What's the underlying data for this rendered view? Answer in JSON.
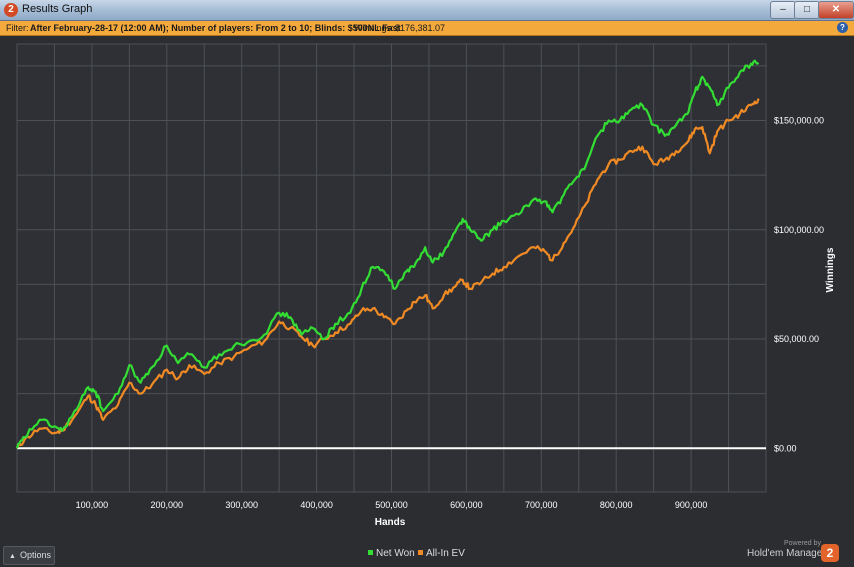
{
  "window": {
    "title": "Results Graph",
    "app_icon_text": "2",
    "minimize_glyph": "–",
    "maximize_glyph": "□",
    "close_glyph": "✕"
  },
  "filter": {
    "label": "Filter:",
    "text": "After February-28-17 (12:00 AM); Number of players: From 2 to 10; Blinds: $500NL Fast",
    "winnings_label": "Winnings:",
    "winnings_value": "$176,381.07",
    "help_icon": "?"
  },
  "bottom": {
    "options_label": "Options",
    "options_icon": "caret-up-icon",
    "powered_by": "Powered by",
    "brand_name": "Hold'em Manager",
    "brand_logo_text": "2"
  },
  "colors": {
    "background": "#2b2d31",
    "grid": "#4d5055",
    "net_won": "#33dd33",
    "all_in_ev": "#f08a24",
    "zero_line": "#ffffff",
    "filter_bar": "#f3a93c"
  },
  "chart_data": {
    "type": "line",
    "title": "",
    "xlabel": "Hands",
    "ylabel": "Winnings",
    "xlim": [
      0,
      1000000
    ],
    "ylim": [
      -20000,
      185000
    ],
    "x_ticks": [
      100000,
      200000,
      300000,
      400000,
      500000,
      600000,
      700000,
      800000,
      900000
    ],
    "x_tick_labels": [
      "100,000",
      "200,000",
      "300,000",
      "400,000",
      "500,000",
      "600,000",
      "700,000",
      "800,000",
      "900,000"
    ],
    "y_ticks": [
      0,
      50000,
      100000,
      150000
    ],
    "y_tick_labels": [
      "$0.00",
      "$50,000.00",
      "$100,000.00",
      "$150,000.00"
    ],
    "grid": true,
    "legend_position": "bottom-center",
    "series": [
      {
        "name": "Net Won",
        "color": "#33dd33",
        "x": [
          0,
          10000,
          30000,
          50000,
          60000,
          80000,
          95000,
          105000,
          115000,
          135000,
          150000,
          165000,
          180000,
          200000,
          215000,
          230000,
          250000,
          270000,
          290000,
          310000,
          330000,
          350000,
          365000,
          380000,
          395000,
          410000,
          425000,
          445000,
          460000,
          475000,
          490000,
          505000,
          520000,
          530000,
          545000,
          555000,
          570000,
          585000,
          595000,
          605000,
          620000,
          635000,
          650000,
          670000,
          690000,
          705000,
          715000,
          730000,
          745000,
          760000,
          775000,
          790000,
          805000,
          820000,
          835000,
          850000,
          865000,
          880000,
          895000,
          905000,
          915000,
          925000,
          935000,
          950000,
          965000,
          980000,
          990000
        ],
        "y": [
          0,
          5000,
          13000,
          10000,
          8000,
          18000,
          28000,
          26000,
          17000,
          25000,
          38000,
          30000,
          37000,
          47000,
          39000,
          43000,
          37000,
          43000,
          47000,
          49000,
          52000,
          62000,
          60000,
          52000,
          55000,
          50000,
          57000,
          62000,
          73000,
          83000,
          81000,
          73000,
          81000,
          83000,
          92000,
          85000,
          90000,
          99000,
          105000,
          100000,
          95000,
          100000,
          104000,
          107000,
          114000,
          113000,
          108000,
          116000,
          123000,
          130000,
          143000,
          150000,
          150000,
          155000,
          157000,
          148000,
          143000,
          148000,
          153000,
          163000,
          170000,
          165000,
          157000,
          165000,
          172000,
          176000,
          176381
        ]
      },
      {
        "name": "All-In EV",
        "color": "#f08a24",
        "x": [
          0,
          10000,
          30000,
          50000,
          60000,
          80000,
          95000,
          105000,
          115000,
          135000,
          150000,
          165000,
          180000,
          200000,
          215000,
          230000,
          250000,
          270000,
          290000,
          310000,
          330000,
          350000,
          365000,
          380000,
          395000,
          410000,
          425000,
          445000,
          460000,
          475000,
          490000,
          505000,
          520000,
          530000,
          545000,
          555000,
          570000,
          585000,
          595000,
          605000,
          620000,
          635000,
          650000,
          670000,
          690000,
          705000,
          715000,
          730000,
          745000,
          760000,
          775000,
          790000,
          805000,
          820000,
          835000,
          850000,
          865000,
          880000,
          895000,
          905000,
          915000,
          925000,
          935000,
          950000,
          965000,
          980000,
          990000
        ],
        "y": [
          0,
          4000,
          9000,
          7000,
          8000,
          16000,
          24000,
          20000,
          13000,
          20000,
          30000,
          25000,
          29000,
          36000,
          32000,
          38000,
          34000,
          39000,
          42000,
          46000,
          49000,
          58000,
          55000,
          51000,
          47000,
          50000,
          53000,
          57000,
          63000,
          64000,
          60000,
          57000,
          63000,
          67000,
          70000,
          64000,
          70000,
          74000,
          77000,
          73000,
          76000,
          80000,
          83000,
          88000,
          92000,
          90000,
          86000,
          94000,
          102000,
          112000,
          123000,
          130000,
          132000,
          136000,
          138000,
          130000,
          132000,
          136000,
          140000,
          146000,
          147000,
          135000,
          145000,
          150000,
          153000,
          157000,
          160000
        ]
      }
    ]
  }
}
